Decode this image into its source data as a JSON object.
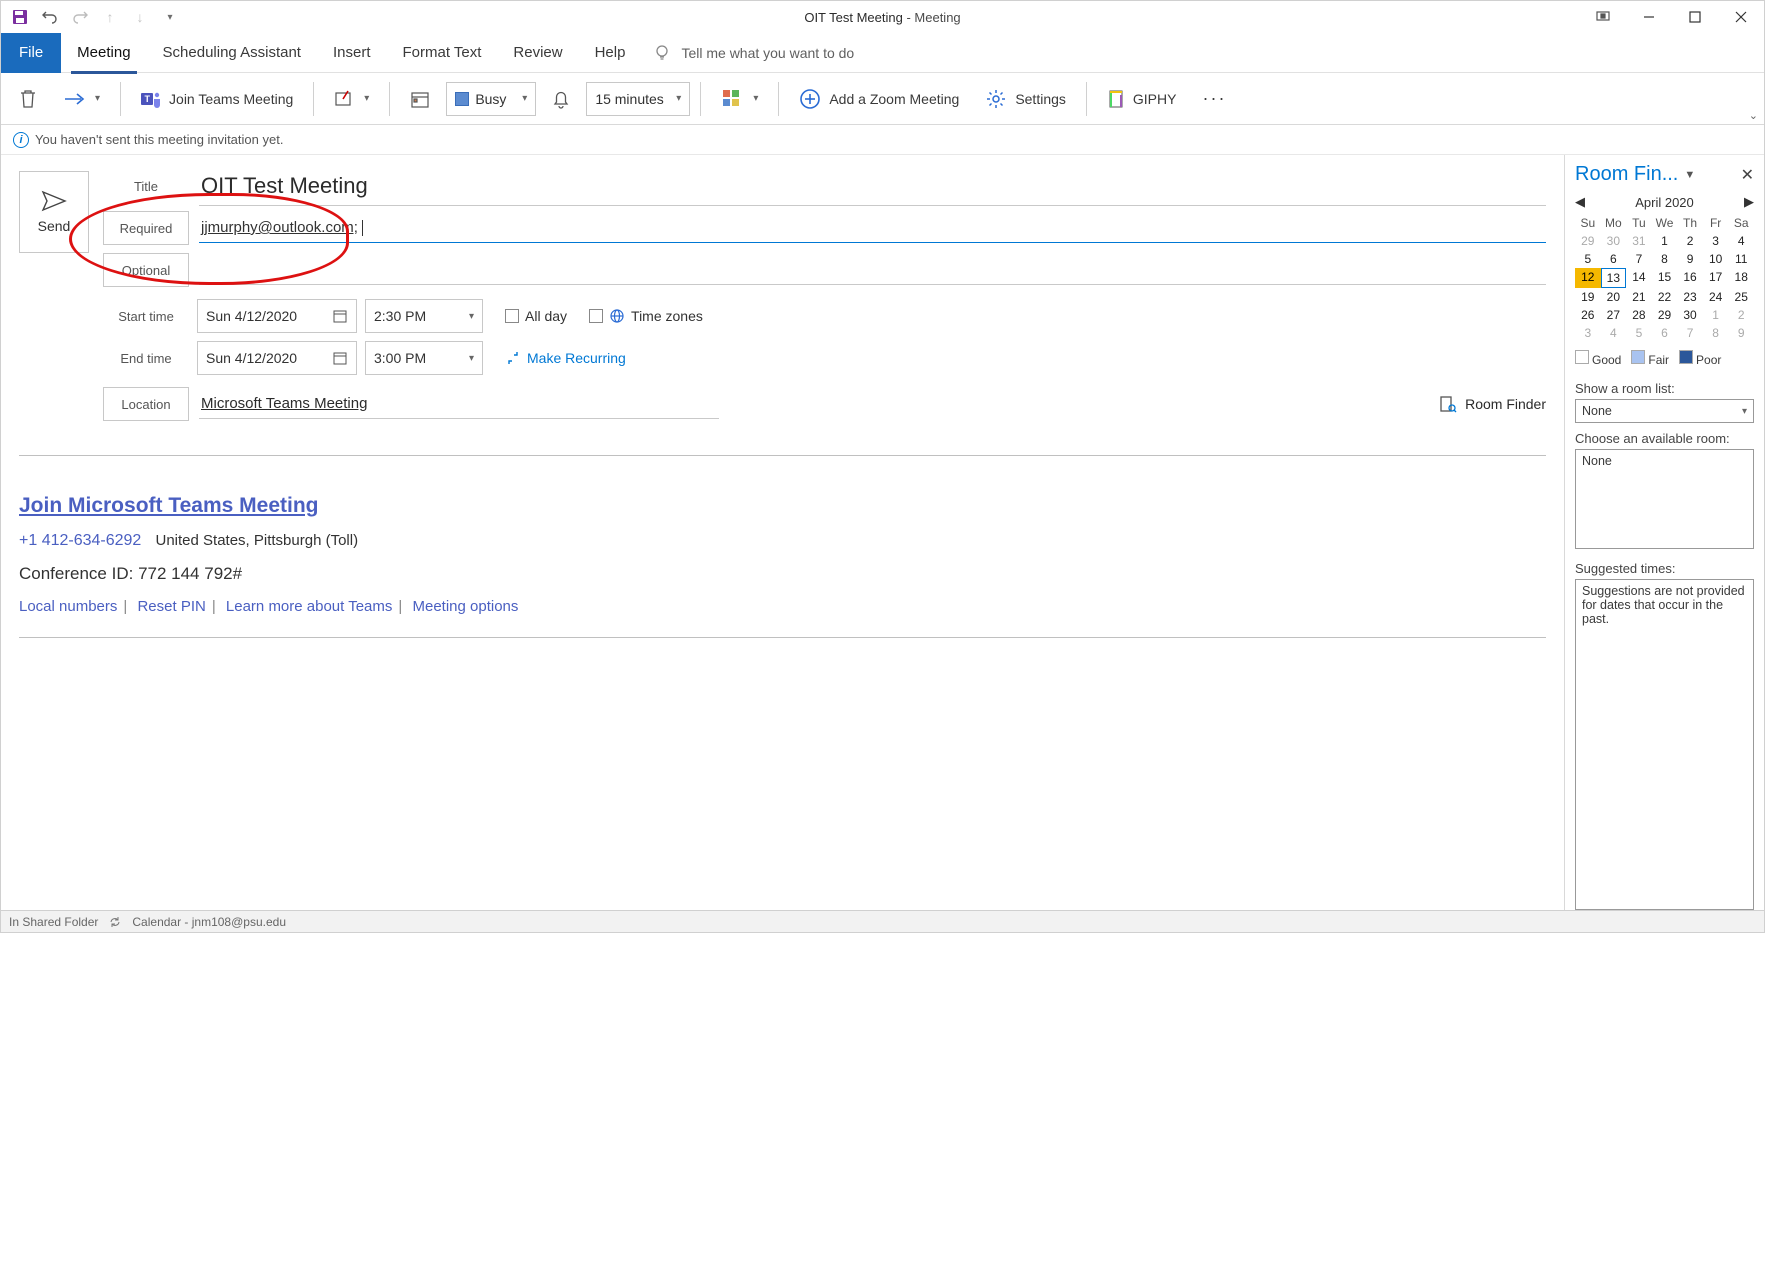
{
  "window_title": {
    "name": "OIT Test Meeting",
    "suffix": "  -  Meeting"
  },
  "tabs": [
    "File",
    "Meeting",
    "Scheduling Assistant",
    "Insert",
    "Format Text",
    "Review",
    "Help"
  ],
  "tell_me": "Tell me what you want to do",
  "ribbon": {
    "join_teams": "Join Teams Meeting",
    "busy": "Busy",
    "reminder": "15 minutes",
    "add_zoom": "Add a Zoom Meeting",
    "settings": "Settings",
    "giphy": "GIPHY"
  },
  "info_bar": "You haven't sent this meeting invitation yet.",
  "form": {
    "send": "Send",
    "title_label": "Title",
    "title_value": "OIT Test Meeting",
    "required_label": "Required",
    "required_value": "jjmurphy@outlook.com;",
    "optional_label": "Optional",
    "start_label": "Start time",
    "start_date": "Sun 4/12/2020",
    "start_time": "2:30 PM",
    "end_label": "End time",
    "end_date": "Sun 4/12/2020",
    "end_time": "3:00 PM",
    "all_day": "All day",
    "time_zones": "Time zones",
    "make_recurring": "Make Recurring",
    "location_label": "Location",
    "location_value": "Microsoft Teams Meeting",
    "room_finder": "Room Finder"
  },
  "body": {
    "join_link": "Join Microsoft Teams Meeting",
    "phone": "+1 412-634-6292",
    "phone_loc": "United States, Pittsburgh (Toll)",
    "conf_label": "Conference ID: ",
    "conf_id": "772 144 792#",
    "links": [
      "Local numbers",
      "Reset PIN",
      "Learn more about Teams",
      "Meeting options"
    ]
  },
  "room_pane": {
    "title": "Room Fin...",
    "month": "April 2020",
    "dow": [
      "Su",
      "Mo",
      "Tu",
      "We",
      "Th",
      "Fr",
      "Sa"
    ],
    "weeks": [
      [
        {
          "n": "29",
          "o": true
        },
        {
          "n": "30",
          "o": true
        },
        {
          "n": "31",
          "o": true
        },
        {
          "n": "1"
        },
        {
          "n": "2"
        },
        {
          "n": "3"
        },
        {
          "n": "4"
        }
      ],
      [
        {
          "n": "5"
        },
        {
          "n": "6"
        },
        {
          "n": "7"
        },
        {
          "n": "8"
        },
        {
          "n": "9"
        },
        {
          "n": "10"
        },
        {
          "n": "11"
        }
      ],
      [
        {
          "n": "12",
          "sel": true
        },
        {
          "n": "13",
          "today": true
        },
        {
          "n": "14"
        },
        {
          "n": "15"
        },
        {
          "n": "16"
        },
        {
          "n": "17"
        },
        {
          "n": "18"
        }
      ],
      [
        {
          "n": "19"
        },
        {
          "n": "20"
        },
        {
          "n": "21"
        },
        {
          "n": "22"
        },
        {
          "n": "23"
        },
        {
          "n": "24"
        },
        {
          "n": "25"
        }
      ],
      [
        {
          "n": "26"
        },
        {
          "n": "27"
        },
        {
          "n": "28"
        },
        {
          "n": "29"
        },
        {
          "n": "30"
        },
        {
          "n": "1",
          "o": true
        },
        {
          "n": "2",
          "o": true
        }
      ],
      [
        {
          "n": "3",
          "o": true
        },
        {
          "n": "4",
          "o": true
        },
        {
          "n": "5",
          "o": true
        },
        {
          "n": "6",
          "o": true
        },
        {
          "n": "7",
          "o": true
        },
        {
          "n": "8",
          "o": true
        },
        {
          "n": "9",
          "o": true
        }
      ]
    ],
    "legend": {
      "good": "Good",
      "fair": "Fair",
      "poor": "Poor"
    },
    "show_list": "Show a room list:",
    "room_list_value": "None",
    "choose_room": "Choose an available room:",
    "room_value": "None",
    "suggested": "Suggested times:",
    "sug_msg": "Suggestions are not provided for dates that occur in the past."
  },
  "status": {
    "folder": "In Shared Folder",
    "calendar": "Calendar - jnm108@psu.edu"
  }
}
